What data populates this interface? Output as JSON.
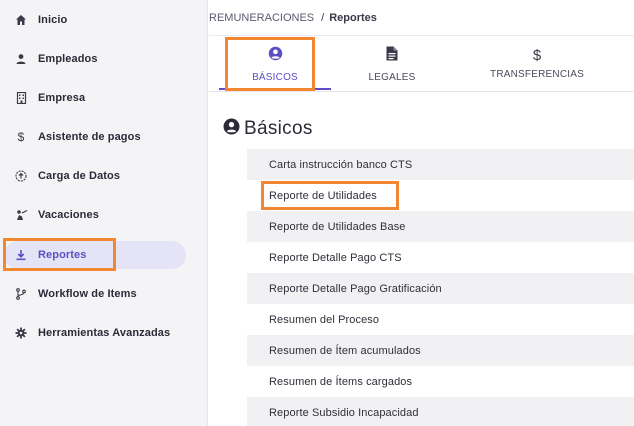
{
  "sidebar": {
    "items": [
      {
        "label": "Inicio",
        "icon": "home-icon"
      },
      {
        "label": "Empleados",
        "icon": "person-icon"
      },
      {
        "label": "Empresa",
        "icon": "building-icon"
      },
      {
        "label": "Asistente de pagos",
        "icon": "dollar-icon"
      },
      {
        "label": "Carga de Datos",
        "icon": "upload-circle-icon"
      },
      {
        "label": "Vacaciones",
        "icon": "beach-person-icon"
      },
      {
        "label": "Reportes",
        "icon": "download-icon",
        "active": true
      },
      {
        "label": "Workflow de Items",
        "icon": "branch-icon"
      },
      {
        "label": "Herramientas Avanzadas",
        "icon": "gear-icon"
      }
    ]
  },
  "breadcrumb": {
    "parent": "REMUNERACIONES",
    "separator": "/",
    "current": "Reportes"
  },
  "tabs": [
    {
      "label": "BÁSICOS",
      "icon": "user-circle-icon",
      "active": true
    },
    {
      "label": "LEGALES",
      "icon": "document-icon"
    },
    {
      "label": "TRANSFERENCIAS",
      "icon": "dollar-icon"
    }
  ],
  "section": {
    "title": "Básicos",
    "icon": "user-circle-icon"
  },
  "reports": [
    "Carta instrucción banco CTS",
    "Reporte de Utilidades",
    "Reporte de Utilidades Base",
    "Reporte Detalle Pago CTS",
    "Reporte Detalle Pago Gratificación",
    "Resumen del Proceso",
    "Resumen de Ítem acumulados",
    "Resumen de Ítems cargados",
    "Reporte Subsidio Incapacidad"
  ],
  "colors": {
    "accent": "#5c4fc4",
    "highlight": "#f38631",
    "sidebar_bg": "#f4f4f7",
    "active_bg": "#e5e3f6",
    "row_shade": "#f1f1f3"
  }
}
